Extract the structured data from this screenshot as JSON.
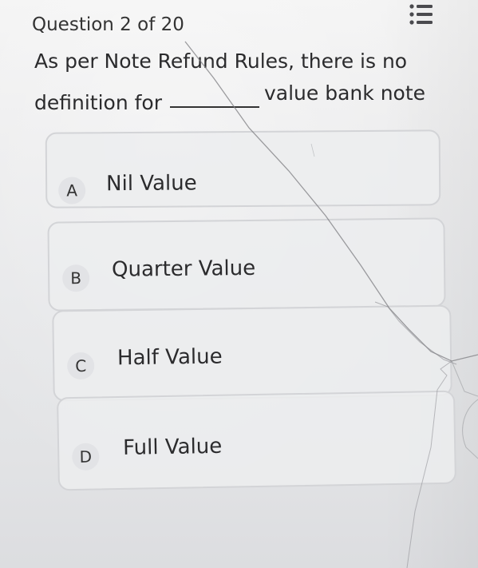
{
  "header": {
    "counter": "Question 2 of 20",
    "menu_icon": "list-icon"
  },
  "question": {
    "line1": "As per Note Refund Rules, there is no",
    "line2_before": "definition for",
    "line2_after": "value bank note"
  },
  "options": [
    {
      "letter": "A",
      "label": "Nil Value"
    },
    {
      "letter": "B",
      "label": "Quarter Value"
    },
    {
      "letter": "C",
      "label": "Half Value"
    },
    {
      "letter": "D",
      "label": "Full Value"
    }
  ]
}
